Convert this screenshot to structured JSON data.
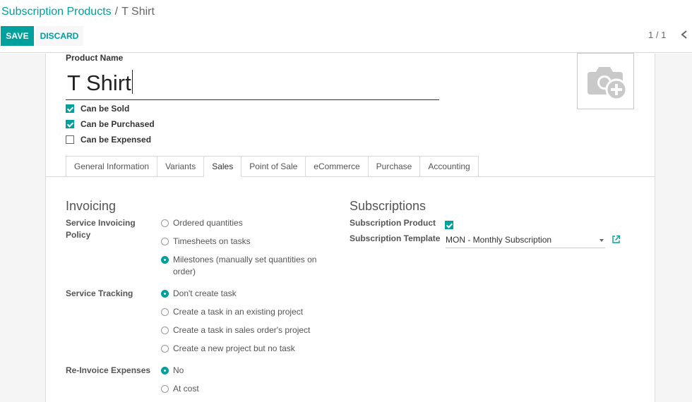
{
  "breadcrumb": {
    "parent": "Subscription Products",
    "separator": "/",
    "current": "T Shirt"
  },
  "toolbar": {
    "save_label": "SAVE",
    "discard_label": "DISCARD"
  },
  "pager": {
    "value": "1 / 1"
  },
  "product": {
    "name_label": "Product Name",
    "name_value": "T Shirt",
    "checks": [
      {
        "label": "Can be Sold",
        "checked": true
      },
      {
        "label": "Can be Purchased",
        "checked": true
      },
      {
        "label": "Can be Expensed",
        "checked": false
      }
    ]
  },
  "tabs": [
    {
      "label": "General Information",
      "active": false
    },
    {
      "label": "Variants",
      "active": false
    },
    {
      "label": "Sales",
      "active": true
    },
    {
      "label": "Point of Sale",
      "active": false
    },
    {
      "label": "eCommerce",
      "active": false
    },
    {
      "label": "Purchase",
      "active": false
    },
    {
      "label": "Accounting",
      "active": false
    }
  ],
  "invoicing": {
    "title": "Invoicing",
    "policy_label": "Service Invoicing Policy",
    "policy_options": [
      {
        "label": "Ordered quantities",
        "selected": false
      },
      {
        "label": "Timesheets on tasks",
        "selected": false
      },
      {
        "label": "Milestones (manually set quantities on order)",
        "selected": true
      }
    ],
    "tracking_label": "Service Tracking",
    "tracking_options": [
      {
        "label": "Don't create task",
        "selected": true
      },
      {
        "label": "Create a task in an existing project",
        "selected": false
      },
      {
        "label": "Create a task in sales order's project",
        "selected": false
      },
      {
        "label": "Create a new project but no task",
        "selected": false
      }
    ],
    "reinvoice_label": "Re-Invoice Expenses",
    "reinvoice_options": [
      {
        "label": "No",
        "selected": true
      },
      {
        "label": "At cost",
        "selected": false
      }
    ]
  },
  "subscriptions": {
    "title": "Subscriptions",
    "product_label": "Subscription Product",
    "product_checked": true,
    "template_label": "Subscription Template",
    "template_value": "MON - Monthly Subscription"
  },
  "colors": {
    "accent": "#00a09d"
  },
  "icons": {
    "image_placeholder": "camera-add-icon",
    "pager_prev": "chevron-left-icon",
    "external_link": "external-link-icon",
    "dropdown": "caret-down-icon"
  }
}
